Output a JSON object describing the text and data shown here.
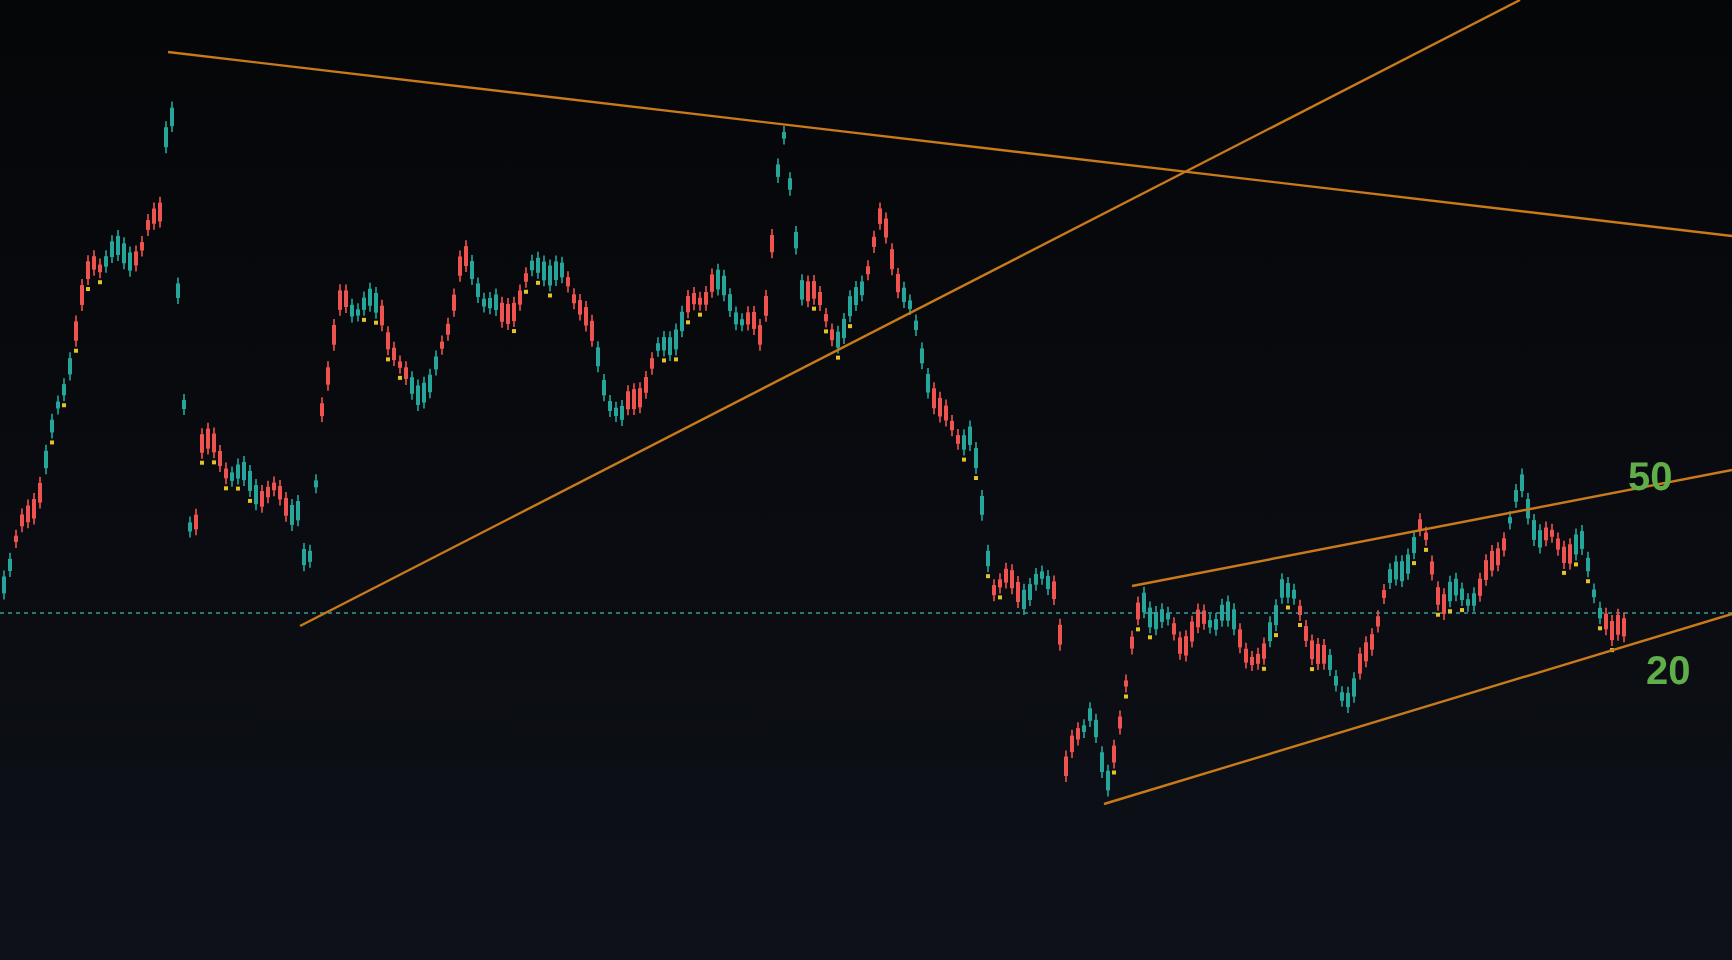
{
  "chart": {
    "labels": [
      {
        "text": "50"
      },
      {
        "text": "20"
      }
    ]
  }
}
